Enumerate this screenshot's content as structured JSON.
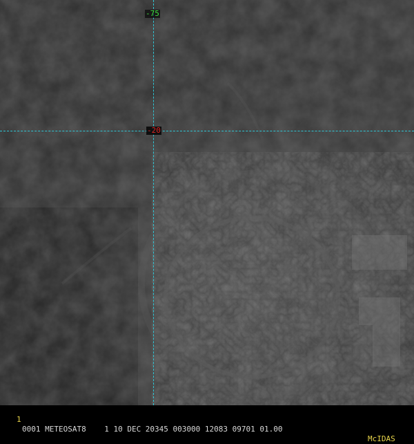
{
  "imagery": {
    "description_colors": {
      "background": "#000000",
      "grid": "#2fc7d6"
    }
  },
  "grid": {
    "longitude_label": "-75",
    "latitude_label": "-20",
    "longitude_label_color": "#3fdc3f",
    "latitude_label_color": "#e02020"
  },
  "status_bar": {
    "frame_number": "1",
    "header": "0001 METEOSAT8    1 10 DEC 20345 003000 12083 09701 01.00",
    "brand": "McIDAS"
  }
}
